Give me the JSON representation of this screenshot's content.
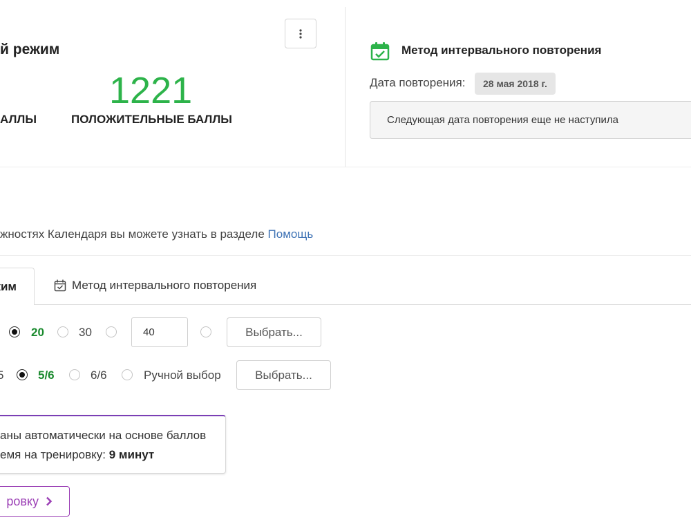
{
  "header": {
    "mode_title": "й режим",
    "big_number": "1221",
    "negative_label": "АЛЛЫ",
    "positive_label": "ПОЛОЖИТЕЛЬНЫЕ БАЛЛЫ"
  },
  "interval_panel": {
    "title": "Метод интервального повторения",
    "repeat_date_label": "Дата повторения:",
    "repeat_date": "28 мая 2018 г.",
    "notice": "Следующая дата повторения еще не наступила"
  },
  "help": {
    "text": "жностях Календаря вы можете узнать в разделе ",
    "link": "Помощь"
  },
  "tabs": {
    "active": "жим",
    "interval": "Метод интервального повторения"
  },
  "word_count_row": {
    "options": [
      "20",
      "30"
    ],
    "selected": "20",
    "custom_value": "40",
    "choose_button": "Выбрать..."
  },
  "level_row": {
    "cut_prefix": "5",
    "options": [
      "5/6",
      "6/6",
      "Ручной выбор"
    ],
    "selected": "5/6",
    "choose_button": "Выбрать..."
  },
  "info": {
    "line1": "аны автоматически на основе баллов",
    "line2_prefix": "емя на тренировку: ",
    "line2_value": "9 минут"
  },
  "start_button": {
    "label": "ровку"
  },
  "colors": {
    "accent_green": "#2db34a",
    "accent_purple": "#9b3fb5",
    "link_blue": "#3f73b5"
  }
}
